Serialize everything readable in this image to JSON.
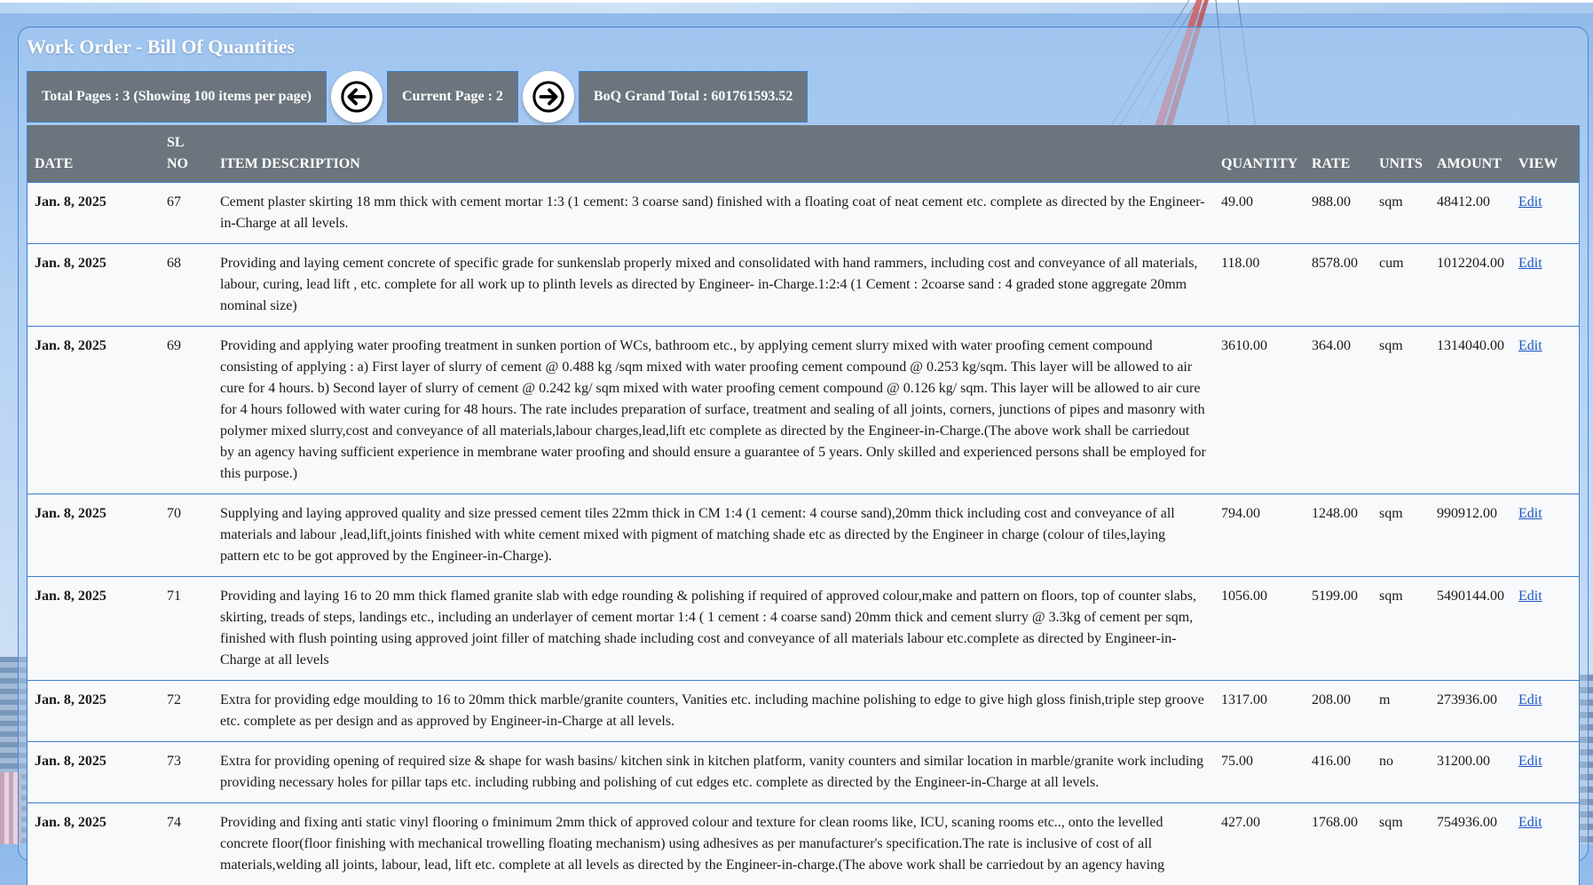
{
  "title": "Work Order - Bill Of Quantities",
  "toolbar": {
    "total_pages": "Total Pages : 3 (Showing 100 items per page)",
    "current_page": "Current Page : 2",
    "grand_total": "BoQ Grand Total : 601761593.52"
  },
  "table": {
    "headers": {
      "date": "DATE",
      "sl_no": "SL NO",
      "description": "ITEM DESCRIPTION",
      "quantity": "QUANTITY",
      "rate": "RATE",
      "units": "UNITS",
      "amount": "AMOUNT",
      "view": "VIEW"
    },
    "rows": [
      {
        "date": "Jan. 8, 2025",
        "sl": "67",
        "desc": "Cement plaster skirting 18 mm thick with cement mortar 1:3 (1 cement: 3 coarse sand) finished with a floating coat of neat cement etc. complete as directed by the Engineer-in-Charge at all levels.",
        "qty": "49.00",
        "rate": "988.00",
        "units": "sqm",
        "amount": "48412.00",
        "action": "Edit"
      },
      {
        "date": "Jan. 8, 2025",
        "sl": "68",
        "desc": "Providing and laying cement concrete of specific grade for sunkenslab properly mixed and consolidated with hand rammers, including cost and conveyance of all materials, labour, curing, lead lift , etc. complete for all work up to plinth levels as directed by Engineer- in-Charge.1:2:4 (1 Cement : 2coarse sand : 4 graded stone aggregate 20mm nominal size)",
        "qty": "118.00",
        "rate": "8578.00",
        "units": "cum",
        "amount": "1012204.00",
        "action": "Edit"
      },
      {
        "date": "Jan. 8, 2025",
        "sl": "69",
        "desc": "Providing and applying water proofing treatment in sunken portion of WCs, bathroom etc., by applying cement slurry mixed with water proofing cement compound consisting of applying : a) First layer of slurry of cement @ 0.488 kg /sqm mixed with water proofing cement compound @ 0.253 kg/sqm. This layer will be allowed to air cure for 4 hours. b) Second layer of slurry of cement @ 0.242 kg/ sqm mixed with water proofing cement compound @ 0.126 kg/ sqm. This layer will be allowed to air cure for 4 hours followed with water curing for 48 hours. The rate includes preparation of surface, treatment and sealing of all joints, corners, junctions of pipes and masonry with polymer mixed slurry,cost and conveyance of all materials,labour charges,lead,lift etc complete as directed by the Engineer-in-Charge.(The above work shall be carriedout by an agency having sufficient experience in membrane water proofing and should ensure a guarantee of 5 years. Only skilled and experienced persons shall be employed for this purpose.)",
        "qty": "3610.00",
        "rate": "364.00",
        "units": "sqm",
        "amount": "1314040.00",
        "action": "Edit"
      },
      {
        "date": "Jan. 8, 2025",
        "sl": "70",
        "desc": "Supplying and laying approved quality and size pressed cement tiles 22mm thick in CM 1:4 (1 cement: 4 course sand),20mm thick including cost and conveyance of all materials and labour ,lead,lift,joints finished with white cement mixed with pigment of matching shade etc as directed by the Engineer in charge (colour of tiles,laying pattern etc to be got approved by the Engineer-in-Charge).",
        "qty": "794.00",
        "rate": "1248.00",
        "units": "sqm",
        "amount": "990912.00",
        "action": "Edit"
      },
      {
        "date": "Jan. 8, 2025",
        "sl": "71",
        "desc": "Providing and laying 16 to 20 mm thick flamed granite slab with edge rounding & polishing if required of approved colour,make and pattern on floors, top of counter slabs, skirting, treads of steps, landings etc., including an underlayer of cement mortar 1:4 ( 1 cement : 4 coarse sand) 20mm thick and cement slurry @ 3.3kg of cement per sqm, finished with flush pointing using approved joint filler of matching shade including cost and conveyance of all materials labour etc.complete as directed by Engineer-in-Charge at all levels",
        "qty": "1056.00",
        "rate": "5199.00",
        "units": "sqm",
        "amount": "5490144.00",
        "action": "Edit"
      },
      {
        "date": "Jan. 8, 2025",
        "sl": "72",
        "desc": "Extra for providing edge moulding to 16 to 20mm thick marble/granite counters, Vanities etc. including machine polishing to edge to give high gloss finish,triple step groove etc. complete as per design and as approved by Engineer-in-Charge at all levels.",
        "qty": "1317.00",
        "rate": "208.00",
        "units": "m",
        "amount": "273936.00",
        "action": "Edit"
      },
      {
        "date": "Jan. 8, 2025",
        "sl": "73",
        "desc": "Extra for providing opening of required size & shape for wash basins/ kitchen sink in kitchen platform, vanity counters and similar location in marble/granite work including providing necessary holes for pillar taps etc. including rubbing and polishing of cut edges etc. complete as directed by the Engineer-in-Charge at all levels.",
        "qty": "75.00",
        "rate": "416.00",
        "units": "no",
        "amount": "31200.00",
        "action": "Edit"
      },
      {
        "date": "Jan. 8, 2025",
        "sl": "74",
        "desc": "Providing and fixing anti static vinyl flooring o fminimum 2mm thick of approved colour and texture for clean rooms like, ICU, scaning rooms etc.., onto the levelled concrete floor(floor finishing with mechanical trowelling floating mechanism) using adhesives as per manufacturer's specification.The rate is inclusive of cost of all materials,welding all joints, labour, lead, lift etc. complete at all levels as directed by the Engineer-in-charge.(The above work shall be carriedout by an agency having",
        "qty": "427.00",
        "rate": "1768.00",
        "units": "sqm",
        "amount": "754936.00",
        "action": "Edit"
      }
    ]
  }
}
